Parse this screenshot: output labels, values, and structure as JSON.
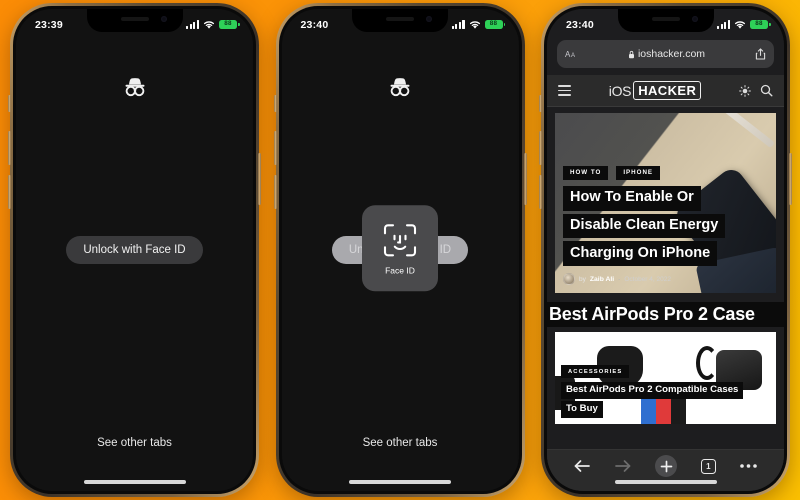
{
  "background": {
    "color_left": "#fb8c06",
    "color_right": "#fbc000"
  },
  "phones": [
    {
      "id": "phone-private-locked",
      "status_bar": {
        "time": "23:39",
        "battery_text": "88",
        "battery_color": "#2ed158"
      },
      "screen": {
        "type": "private-tab-locked",
        "incognito_icon": "incognito-icon",
        "unlock_button": "Unlock with Face ID",
        "see_other_tabs": "See other tabs"
      }
    },
    {
      "id": "phone-faceid-prompt",
      "status_bar": {
        "time": "23:40",
        "battery_text": "88",
        "battery_color": "#2ed158"
      },
      "screen": {
        "type": "private-tab-faceid",
        "incognito_icon": "incognito-icon",
        "unlock_button": "Unlock with Face ID",
        "see_other_tabs": "See other tabs",
        "faceid_modal": {
          "label": "Face ID",
          "icon": "face-id-icon"
        }
      }
    },
    {
      "id": "phone-safari-site",
      "status_bar": {
        "time": "23:40",
        "battery_text": "88",
        "battery_color": "#2ed158"
      },
      "screen": {
        "type": "safari-browser",
        "address_bar": {
          "url": "ioshacker.com",
          "lock_icon": "lock-icon",
          "aa_icon": "page-settings-icon",
          "share_icon": "share-icon"
        },
        "site_header": {
          "menu_icon": "hamburger-menu-icon",
          "logo_prefix": "iOS",
          "logo_boxed": "HACKER",
          "theme_icon": "brightness-icon",
          "search_icon": "search-icon"
        },
        "article": {
          "tags": [
            "HOW TO",
            "IPHONE"
          ],
          "headline_lines": [
            "How To Enable Or",
            "Disable Clean Energy",
            "Charging On iPhone"
          ],
          "byline_prefix": "by",
          "author": "Zaib Ali",
          "separator": "-",
          "date": "October 4, 2022"
        },
        "section_title": "Best AirPods Pro 2 Case",
        "article2": {
          "tag": "ACCESSORIES",
          "headline_lines": [
            "Best AirPods Pro 2 Compatible Cases",
            "To Buy"
          ]
        },
        "toolbar": {
          "back_icon": "back-arrow-icon",
          "forward_icon": "forward-arrow-icon",
          "add_icon": "plus-icon",
          "tab_count": "1",
          "more_icon": "more-options-icon"
        }
      }
    }
  ]
}
